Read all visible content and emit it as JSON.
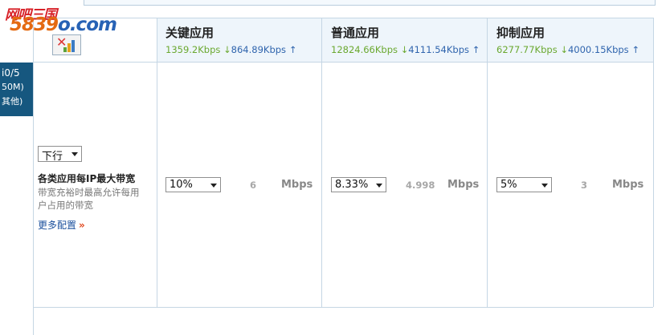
{
  "watermark": {
    "line1": "网吧三国",
    "line2_a": "5839",
    "line2_b": "o.com"
  },
  "sidebar": {
    "line1": "i0/5",
    "line2": "50M)",
    "line3": "其他)"
  },
  "row": {
    "direction": "下行",
    "label_strong": "各类应用每IP最大带宽",
    "label_desc": "带宽充裕时最高允许每用户占用的带宽",
    "more_link": "更多配置",
    "more_chevron": "»"
  },
  "columns": [
    {
      "title": "关键应用",
      "up_rate": "1359.2Kbps ↓",
      "down_rate": "864.89Kbps ↑",
      "select_value": "10%",
      "number": "6",
      "unit": "Mbps"
    },
    {
      "title": "普通应用",
      "up_rate": "12824.66Kbps ↓",
      "down_rate": "4111.54Kbps ↑",
      "select_value": "8.33%",
      "number": "4.998",
      "unit": "Mbps"
    },
    {
      "title": "抑制应用",
      "up_rate": "6277.77Kbps ↓",
      "down_rate": "4000.15Kbps ↑",
      "select_value": "5%",
      "number": "3",
      "unit": "Mbps"
    }
  ],
  "colors": {
    "up": "#6aa82f",
    "down": "#2f64ad",
    "sidebar": "#16577f"
  },
  "icons": {
    "corner": "chart-settings-icon"
  }
}
